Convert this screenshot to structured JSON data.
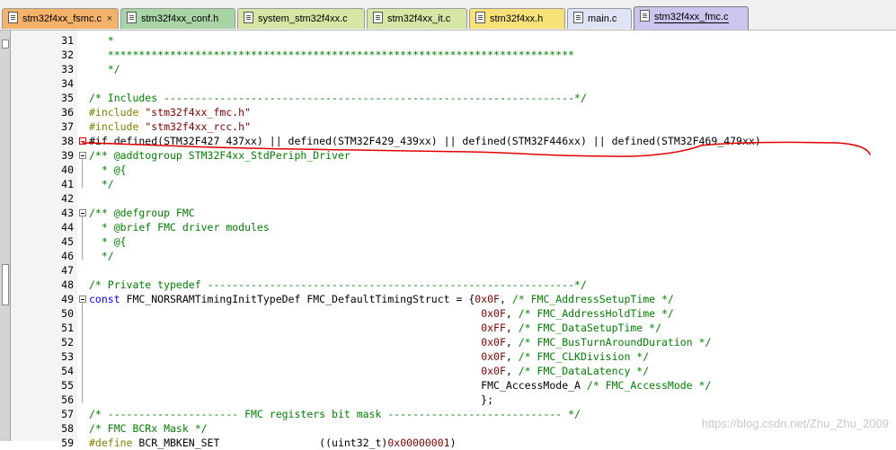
{
  "tabs": [
    {
      "label": "stm32f4xx_fsmc.c",
      "color": "#f5b26b",
      "close": "×"
    },
    {
      "label": "stm32f4xx_conf.h",
      "color": "#a9d4a4",
      "close": ""
    },
    {
      "label": "system_stm32f4xx.c",
      "color": "#d6e6a4",
      "close": ""
    },
    {
      "label": "stm32f4xx_it.c",
      "color": "#d6e6a4",
      "close": ""
    },
    {
      "label": "stm32f4xx.h",
      "color": "#f7e27a",
      "close": ""
    },
    {
      "label": "main.c",
      "color": "#dfe4f4",
      "close": ""
    },
    {
      "label": "stm32f4xx_fmc.c",
      "color": "#ccc6ee",
      "close": ""
    }
  ],
  "editor": {
    "lines": [
      {
        "n": "31",
        "segs": [
          {
            "t": "   *",
            "c": "c-comment"
          }
        ]
      },
      {
        "n": "32",
        "segs": [
          {
            "t": "   ***************************************************************************",
            "c": "c-comment"
          }
        ]
      },
      {
        "n": "33",
        "segs": [
          {
            "t": "   */",
            "c": "c-comment"
          }
        ]
      },
      {
        "n": "34",
        "segs": []
      },
      {
        "n": "35",
        "segs": [
          {
            "t": "/* Includes ------------------------------------------------------------------*/",
            "c": "c-comment"
          }
        ]
      },
      {
        "n": "36",
        "segs": [
          {
            "t": "#include ",
            "c": "c-pre"
          },
          {
            "t": "\"stm32f4xx_fmc.h\"",
            "c": "c-str"
          }
        ]
      },
      {
        "n": "37",
        "segs": [
          {
            "t": "#include ",
            "c": "c-pre"
          },
          {
            "t": "\"stm32f4xx_rcc.h\"",
            "c": "c-str"
          }
        ]
      },
      {
        "n": "38",
        "segs": [
          {
            "t": "#if defined(STM32F427_437xx) || defined(STM32F429_439xx) || defined(STM32F446xx) || defined(STM32F469_479xx)",
            "c": ""
          }
        ]
      },
      {
        "n": "39",
        "segs": [
          {
            "t": "/** @addtogroup STM32F4xx_StdPeriph_Driver",
            "c": "c-comment"
          }
        ]
      },
      {
        "n": "40",
        "segs": [
          {
            "t": "  * @{",
            "c": "c-comment"
          }
        ]
      },
      {
        "n": "41",
        "segs": [
          {
            "t": "  */",
            "c": "c-comment"
          }
        ]
      },
      {
        "n": "42",
        "segs": []
      },
      {
        "n": "43",
        "segs": [
          {
            "t": "/** @defgroup FMC",
            "c": "c-comment"
          }
        ]
      },
      {
        "n": "44",
        "segs": [
          {
            "t": "  * @brief FMC driver modules",
            "c": "c-comment"
          }
        ]
      },
      {
        "n": "45",
        "segs": [
          {
            "t": "  * @{",
            "c": "c-comment"
          }
        ]
      },
      {
        "n": "46",
        "segs": [
          {
            "t": "  */",
            "c": "c-comment"
          }
        ]
      },
      {
        "n": "47",
        "segs": []
      },
      {
        "n": "48",
        "segs": [
          {
            "t": "/* Private typedef -----------------------------------------------------------*/",
            "c": "c-comment"
          }
        ]
      },
      {
        "n": "49",
        "segs": [
          {
            "t": "const ",
            "c": "c-kw"
          },
          {
            "t": "FMC_NORSRAMTimingInitTypeDef FMC_DefaultTimingStruct = {",
            "c": ""
          },
          {
            "t": "0x0F",
            "c": "c-str"
          },
          {
            "t": ", ",
            "c": ""
          },
          {
            "t": "/* FMC_AddressSetupTime */",
            "c": "c-comment"
          }
        ]
      },
      {
        "n": "50",
        "segs": [
          {
            "t": "                                                               ",
            "c": ""
          },
          {
            "t": "0x0F",
            "c": "c-str"
          },
          {
            "t": ", ",
            "c": ""
          },
          {
            "t": "/* FMC_AddressHoldTime */",
            "c": "c-comment"
          }
        ]
      },
      {
        "n": "51",
        "segs": [
          {
            "t": "                                                               ",
            "c": ""
          },
          {
            "t": "0xFF",
            "c": "c-str"
          },
          {
            "t": ", ",
            "c": ""
          },
          {
            "t": "/* FMC_DataSetupTime */",
            "c": "c-comment"
          }
        ]
      },
      {
        "n": "52",
        "segs": [
          {
            "t": "                                                               ",
            "c": ""
          },
          {
            "t": "0x0F",
            "c": "c-str"
          },
          {
            "t": ", ",
            "c": ""
          },
          {
            "t": "/* FMC_BusTurnAroundDuration */",
            "c": "c-comment"
          }
        ]
      },
      {
        "n": "53",
        "segs": [
          {
            "t": "                                                               ",
            "c": ""
          },
          {
            "t": "0x0F",
            "c": "c-str"
          },
          {
            "t": ", ",
            "c": ""
          },
          {
            "t": "/* FMC_CLKDivision */",
            "c": "c-comment"
          }
        ]
      },
      {
        "n": "54",
        "segs": [
          {
            "t": "                                                               ",
            "c": ""
          },
          {
            "t": "0x0F",
            "c": "c-str"
          },
          {
            "t": ", ",
            "c": ""
          },
          {
            "t": "/* FMC_DataLatency */",
            "c": "c-comment"
          }
        ]
      },
      {
        "n": "55",
        "segs": [
          {
            "t": "                                                               FMC_AccessMode_A ",
            "c": ""
          },
          {
            "t": "/* FMC_AccessMode */",
            "c": "c-comment"
          }
        ]
      },
      {
        "n": "56",
        "segs": [
          {
            "t": "                                                               };",
            "c": ""
          }
        ]
      },
      {
        "n": "57",
        "segs": [
          {
            "t": "/* --------------------- FMC registers bit mask ---------------------------- */",
            "c": "c-comment"
          }
        ]
      },
      {
        "n": "58",
        "segs": [
          {
            "t": "/* FMC BCRx Mask */",
            "c": "c-comment"
          }
        ]
      },
      {
        "n": "59",
        "segs": [
          {
            "t": "#define ",
            "c": "c-pre"
          },
          {
            "t": "BCR_MBKEN_SET                ((uint32_t)",
            "c": ""
          },
          {
            "t": "0x00000001",
            "c": "c-str"
          },
          {
            "t": ")",
            "c": ""
          }
        ]
      }
    ]
  },
  "watermark": "https://blog.csdn.net/Zhu_Zhu_2009",
  "annotation_color": "#e00000"
}
